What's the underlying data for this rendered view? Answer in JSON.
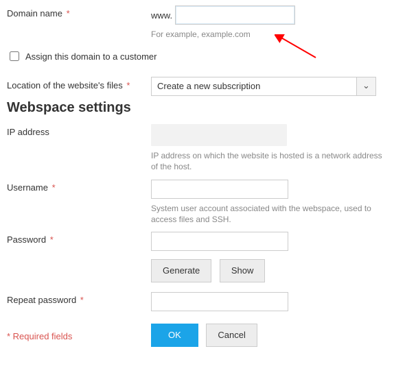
{
  "domain": {
    "label": "Domain name",
    "prefix": "www.",
    "value": "",
    "hint": "For example, example.com"
  },
  "assign": {
    "label": "Assign this domain to a customer",
    "checked": false
  },
  "location": {
    "label": "Location of the website's files",
    "selected": "Create a new subscription"
  },
  "section_title": "Webspace settings",
  "ip": {
    "label": "IP address",
    "value": "",
    "hint": "IP address on which the website is hosted is a network address of the host."
  },
  "username": {
    "label": "Username",
    "value": "",
    "hint": "System user account associated with the webspace, used to access files and SSH."
  },
  "password": {
    "label": "Password",
    "value": ""
  },
  "buttons": {
    "generate": "Generate",
    "show": "Show",
    "ok": "OK",
    "cancel": "Cancel"
  },
  "repeat_password": {
    "label": "Repeat password",
    "value": ""
  },
  "required_note": "* Required fields"
}
